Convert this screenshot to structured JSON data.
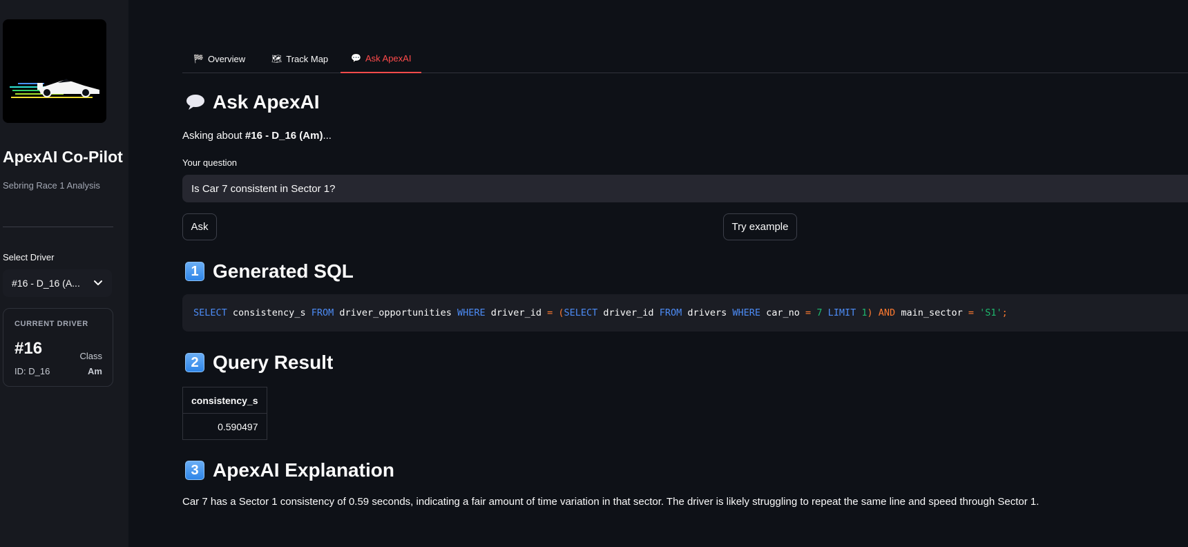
{
  "sidebar": {
    "app_title": "ApexAI Co-Pilot",
    "app_subtitle": "Sebring Race 1 Analysis",
    "select_label": "Select Driver",
    "select_value": "#16 - D_16 (A...",
    "driver_card": {
      "label": "CURRENT DRIVER",
      "number": "#16",
      "class_label": "Class",
      "id_text": "ID: D_16",
      "class_value": "Am"
    }
  },
  "tabs": [
    {
      "label": "Overview",
      "icon": "checkered-flag-icon",
      "glyph": "🏁",
      "active": false
    },
    {
      "label": "Track Map",
      "icon": "map-icon",
      "glyph": "🗺",
      "active": false
    },
    {
      "label": "Ask ApexAI",
      "icon": "speech-bubble-icon",
      "glyph": "💬",
      "active": true
    }
  ],
  "ask": {
    "heading": "Ask ApexAI",
    "asking_prefix": "Asking about ",
    "asking_driver": "#16 - D_16 (Am)",
    "asking_suffix": "...",
    "question_label": "Your question",
    "question_value": "Is Car 7 consistent in Sector 1?",
    "ask_button": "Ask",
    "example_button": "Try example"
  },
  "sections": {
    "sql_num": "1",
    "sql_heading": "Generated SQL",
    "result_num": "2",
    "result_heading": "Query Result",
    "explain_num": "3",
    "explain_heading": "ApexAI Explanation"
  },
  "sql": {
    "tokens": [
      {
        "t": "SELECT",
        "c": "kw"
      },
      {
        "t": " consistency_s ",
        "c": ""
      },
      {
        "t": "FROM",
        "c": "kw"
      },
      {
        "t": " driver_opportunities ",
        "c": ""
      },
      {
        "t": "WHERE",
        "c": "kw"
      },
      {
        "t": " driver_id ",
        "c": ""
      },
      {
        "t": "=",
        "c": "op"
      },
      {
        "t": " ",
        "c": ""
      },
      {
        "t": "(",
        "c": "op"
      },
      {
        "t": "SELECT",
        "c": "kw"
      },
      {
        "t": " driver_id ",
        "c": ""
      },
      {
        "t": "FROM",
        "c": "kw"
      },
      {
        "t": " drivers ",
        "c": ""
      },
      {
        "t": "WHERE",
        "c": "kw"
      },
      {
        "t": " car_no ",
        "c": ""
      },
      {
        "t": "=",
        "c": "op"
      },
      {
        "t": " ",
        "c": ""
      },
      {
        "t": "7",
        "c": "num"
      },
      {
        "t": " ",
        "c": ""
      },
      {
        "t": "LIMIT",
        "c": "kw"
      },
      {
        "t": " ",
        "c": ""
      },
      {
        "t": "1",
        "c": "num"
      },
      {
        "t": ")",
        "c": "op"
      },
      {
        "t": " ",
        "c": ""
      },
      {
        "t": "AND",
        "c": "op"
      },
      {
        "t": " main_sector ",
        "c": ""
      },
      {
        "t": "=",
        "c": "op"
      },
      {
        "t": " ",
        "c": ""
      },
      {
        "t": "'S1'",
        "c": "str"
      },
      {
        "t": ";",
        "c": "op"
      }
    ]
  },
  "result": {
    "column": "consistency_s",
    "value": "0.590497"
  },
  "explanation": "Car 7 has a Sector 1 consistency of 0.59 seconds, indicating a fair amount of time variation in that sector. The driver is likely struggling to repeat the same line and speed through Sector 1.",
  "colors": {
    "background": "#0e1117",
    "sidebar": "#17191f",
    "accent": "#ff4b4b",
    "keyword": "#4c8bf5",
    "operator": "#ff7a30",
    "literal": "#1eb86d"
  }
}
